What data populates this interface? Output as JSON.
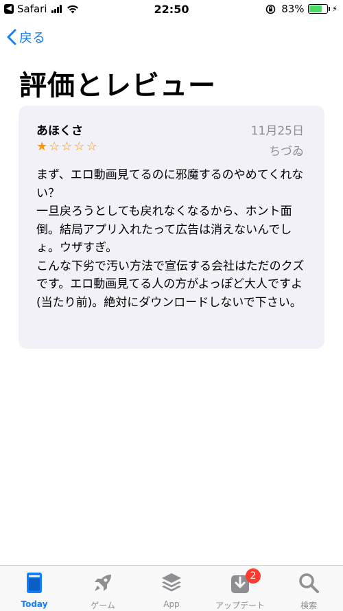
{
  "status_bar": {
    "back_app": "Safari",
    "time": "22:50",
    "battery_percent": "83%",
    "battery_level": 0.83
  },
  "nav": {
    "back_label": "戻る"
  },
  "page": {
    "title": "評価とレビュー"
  },
  "review": {
    "author": "あほくさ",
    "date": "11月25日",
    "nickname": "ちづゐ",
    "rating": 1,
    "max_rating": 5,
    "body": "まず、エロ動画見てるのに邪魔するのやめてくれない？\n一旦戻ろうとしても戻れなくなるから、ホント面倒。結局アプリ入れたって広告は消えないんでしょ。ウザすぎ。\nこんな下劣で汚い方法で宣伝する会社はただのクズです。エロ動画見てる人の方がよっぽど大人ですよ(当たり前)。絶対にダウンロードしないで下さい。"
  },
  "colors": {
    "accent": "#147efb",
    "star": "#ff9500",
    "badge": "#ff3b30",
    "battery": "#4cd964"
  },
  "tabs": [
    {
      "label": "Today",
      "icon": "today-icon",
      "active": true
    },
    {
      "label": "ゲーム",
      "icon": "rocket-icon",
      "active": false
    },
    {
      "label": "App",
      "icon": "layers-icon",
      "active": false
    },
    {
      "label": "アップデート",
      "icon": "download-icon",
      "active": false,
      "badge": "2"
    },
    {
      "label": "検索",
      "icon": "search-icon",
      "active": false
    }
  ]
}
